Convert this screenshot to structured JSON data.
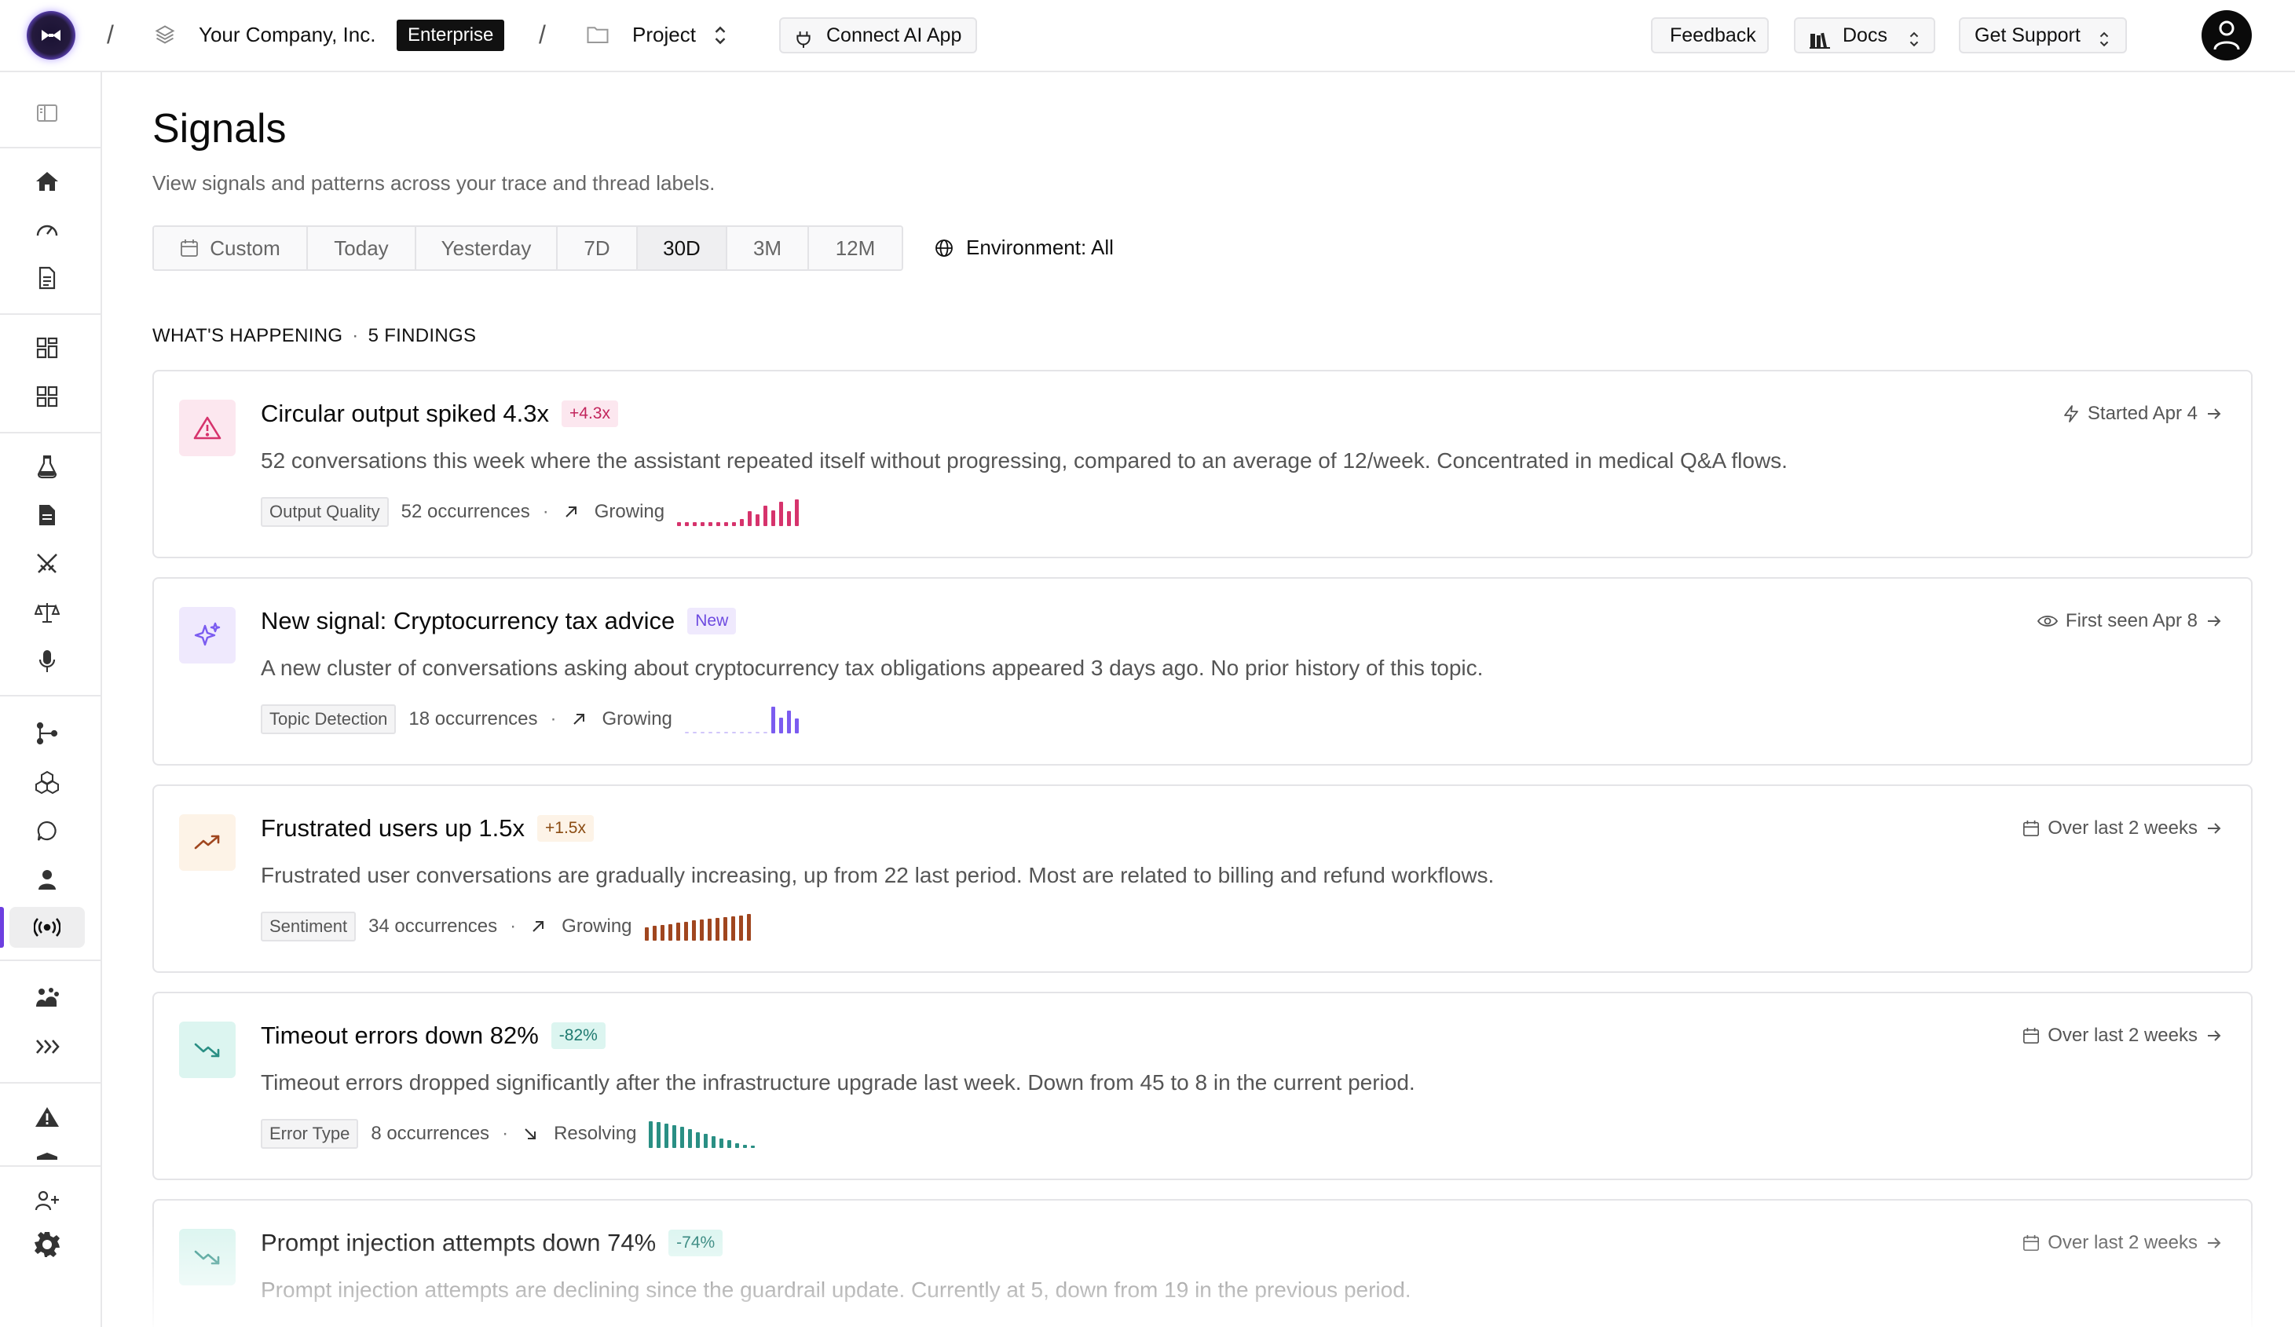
{
  "topbar": {
    "company": "Your Company, Inc.",
    "plan_badge": "Enterprise",
    "project": "Project",
    "connect_label": "Connect AI App",
    "feedback_label": "Feedback",
    "docs_label": "Docs",
    "support_label": "Get Support"
  },
  "page": {
    "title": "Signals",
    "subtitle": "View signals and patterns across your trace and thread labels."
  },
  "filters": {
    "ranges": [
      "Custom",
      "Today",
      "Yesterday",
      "7D",
      "30D",
      "3M",
      "12M"
    ],
    "selected_range": "30D",
    "environment_label": "Environment: All"
  },
  "findings": {
    "heading": "WHAT'S HAPPENING",
    "count_label": "5 FINDINGS",
    "items": [
      {
        "title": "Circular output spiked 4.3x",
        "badge": "+4.3x",
        "description": "52 conversations this week where the assistant repeated itself without progressing, compared to an average of 12/week. Concentrated in medical Q&A flows.",
        "tag": "Output Quality",
        "occurrences": "52 occurrences",
        "trend": "Growing",
        "right_label": "Started Apr 4",
        "icon": "warning-triangle-icon",
        "color": "#d6336c",
        "spark": [
          0.15,
          0.15,
          0.15,
          0.15,
          0.15,
          0.15,
          0.15,
          0.15,
          0.25,
          0.55,
          0.45,
          0.75,
          0.6,
          0.9,
          0.55,
          1.0
        ]
      },
      {
        "title": "New signal: Cryptocurrency tax advice",
        "badge": "New",
        "description": "A new cluster of conversations asking about cryptocurrency tax obligations appeared 3 days ago. No prior history of this topic.",
        "tag": "Topic Detection",
        "occurrences": "18 occurrences",
        "trend": "Growing",
        "right_label": "First seen Apr 8",
        "icon": "sparkles-icon",
        "color": "#7b5cf0",
        "spark": [
          0.03,
          0.03,
          0.03,
          0.03,
          0.03,
          0.03,
          0.03,
          0.03,
          0.03,
          0.03,
          0.03,
          1.0,
          0.6,
          0.85,
          0.55
        ]
      },
      {
        "title": "Frustrated users up 1.5x",
        "badge": "+1.5x",
        "description": "Frustrated user conversations are gradually increasing, up from 22 last period. Most are related to billing and refund workflows.",
        "tag": "Sentiment",
        "occurrences": "34 occurrences",
        "trend": "Growing",
        "right_label": "Over last 2 weeks",
        "icon": "trend-up-icon",
        "color": "#a0461f",
        "spark": [
          0.5,
          0.55,
          0.6,
          0.62,
          0.68,
          0.72,
          0.75,
          0.8,
          0.82,
          0.85,
          0.88,
          0.92,
          0.95,
          1.0
        ]
      },
      {
        "title": "Timeout errors down 82%",
        "badge": "-82%",
        "description": "Timeout errors dropped significantly after the infrastructure upgrade last week. Down from 45 to 8 in the current period.",
        "tag": "Error Type",
        "occurrences": "8 occurrences",
        "trend": "Resolving",
        "right_label": "Over last 2 weeks",
        "icon": "trend-down-icon",
        "color": "#2a8f84",
        "spark": [
          1.0,
          0.98,
          0.92,
          0.85,
          0.78,
          0.7,
          0.6,
          0.52,
          0.45,
          0.35,
          0.28,
          0.18,
          0.12,
          0.08
        ]
      },
      {
        "title": "Prompt injection attempts down 74%",
        "badge": "-74%",
        "description": "Prompt injection attempts are declining since the guardrail update. Currently at 5, down from 19 in the previous period.",
        "tag": "",
        "occurrences": "",
        "trend": "",
        "right_label": "Over last 2 weeks",
        "icon": "trend-down-icon",
        "color": "#2a8f84",
        "spark": []
      }
    ]
  }
}
